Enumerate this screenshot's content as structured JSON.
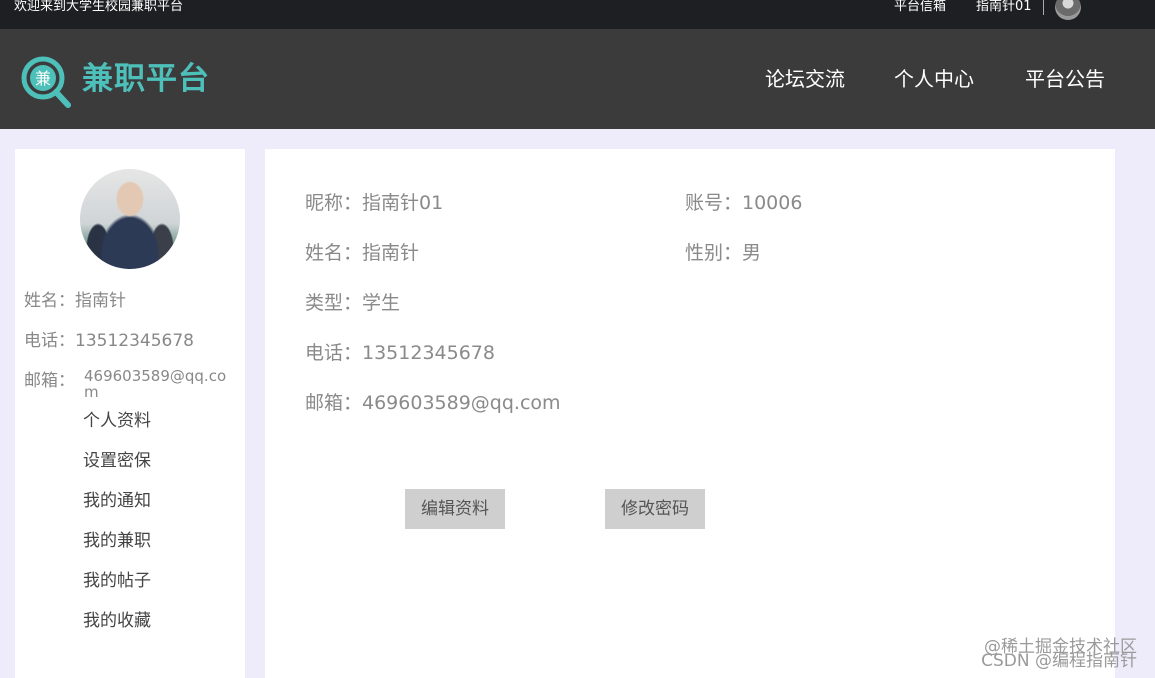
{
  "topbar": {
    "welcome": "欢迎来到大学生校园兼职平台",
    "mailbox": "平台信箱",
    "username": "指南针01"
  },
  "header": {
    "logo_glyph": "兼",
    "logo_text": "兼职平台",
    "brand_color": "#4ec0ba",
    "nav": [
      "论坛交流",
      "个人中心",
      "平台公告"
    ]
  },
  "sidebar": {
    "name": "姓名：指南针",
    "phone": "电话：13512345678",
    "email_label": "邮箱：",
    "email_value": "469603589@qq.com",
    "menu": [
      "个人资料",
      "设置密保",
      "我的通知",
      "我的兼职",
      "我的帖子",
      "我的收藏"
    ]
  },
  "profile": {
    "nickname": "昵称：指南针01",
    "account": "账号：10006",
    "name": "姓名：指南针",
    "gender": "性别：男",
    "type": "类型：学生",
    "phone": "电话：13512345678",
    "email": "邮箱：469603589@qq.com"
  },
  "buttons": {
    "edit": "编辑资料",
    "change_password": "修改密码"
  },
  "watermark": {
    "line1": "@稀土掘金技术社区",
    "line2": "CSDN @编程指南针"
  }
}
